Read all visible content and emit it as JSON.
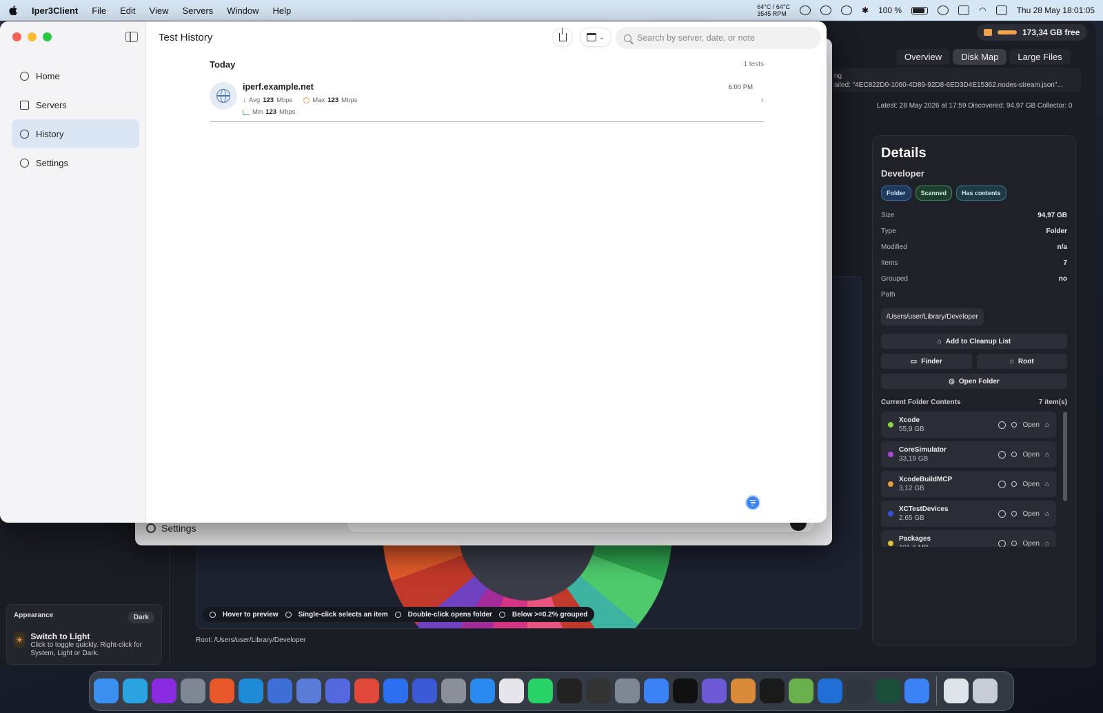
{
  "menubar": {
    "app_name": "Iper3Client",
    "menus": [
      "File",
      "Edit",
      "View",
      "Servers",
      "Window",
      "Help"
    ],
    "temp_line1": "64°C / 64°C",
    "temp_line2": "3545 RPM",
    "battery": "100 %",
    "datetime": "Thu 28 May  18:01:05"
  },
  "background_app": {
    "free_space": "173,34 GB free",
    "tabs": [
      "Overview",
      "Disk Map",
      "Large Files"
    ],
    "active_tab": "Disk Map",
    "log_line1": "ng",
    "log_line2": "ailed: \"4EC822D0-1060-4D89-92D8-6ED3D4E15362.nodes-stream.json\"...",
    "status": "Latest: 28 May 2026 at 17:59   Discovered: 94,97 GB   Collector: 0",
    "details": {
      "title": "Details",
      "name": "Developer",
      "tags": [
        "Folder",
        "Scanned",
        "Has contents"
      ],
      "fields": [
        {
          "k": "Size",
          "v": "94,97 GB"
        },
        {
          "k": "Type",
          "v": "Folder"
        },
        {
          "k": "Modified",
          "v": "n/a"
        },
        {
          "k": "Items",
          "v": "7"
        },
        {
          "k": "Grouped",
          "v": "no"
        },
        {
          "k": "Path",
          "v": ""
        }
      ],
      "path": "/Users/user/Library/Developer",
      "add_cleanup": "Add to Cleanup List",
      "finder": "Finder",
      "root": "Root",
      "open_folder": "Open Folder",
      "contents_label": "Current Folder Contents",
      "contents_count": "7 item(s)",
      "items": [
        {
          "name": "Xcode",
          "size": "55,9 GB",
          "color": "#8bd14a"
        },
        {
          "name": "CoreSimulator",
          "size": "33,19 GB",
          "color": "#a64ad1"
        },
        {
          "name": "XcodeBuildMCP",
          "size": "3,12 GB",
          "color": "#e0a23a"
        },
        {
          "name": "XCTestDevices",
          "size": "2,65 GB",
          "color": "#3a4fd1"
        },
        {
          "name": "Packages",
          "size": "101,6 MB",
          "color": "#e0c23a"
        }
      ],
      "open_label": "Open"
    },
    "hints": [
      "Hover to preview",
      "Single-click selects an item",
      "Double-click opens folder",
      "Below >=0.2% grouped"
    ],
    "root_label": "Root: /Users/user/Library/Developer",
    "appearance": {
      "label": "Appearance",
      "mode": "Dark",
      "title": "Switch to Light",
      "subtitle": "Click to toggle quickly. Right-click for System, Light or Dark."
    }
  },
  "middle_window": {
    "settings_label": "Settings"
  },
  "main_window": {
    "title": "Test History",
    "search_placeholder": "Search by server, date, or note",
    "nav": [
      {
        "label": "Home",
        "icon": "gauge-icon"
      },
      {
        "label": "Servers",
        "icon": "server-icon"
      },
      {
        "label": "History",
        "icon": "clock-icon"
      },
      {
        "label": "Settings",
        "icon": "gear-icon"
      }
    ],
    "active_nav": "History",
    "section": {
      "day": "Today",
      "count": "1 tests"
    },
    "entry": {
      "server": "iperf.example.net",
      "time": "6:00 PM",
      "avg_label": "Avg",
      "avg_value": "123",
      "max_label": "Max",
      "max_value": "123",
      "min_label": "Min",
      "min_value": "123",
      "unit": "Mbps"
    }
  },
  "dock": {
    "apps": [
      {
        "name": "finder",
        "color": "#3b8ff0"
      },
      {
        "name": "telegram",
        "color": "#2aa3e0"
      },
      {
        "name": "phpstorm",
        "color": "#8a2be2"
      },
      {
        "name": "unknown",
        "color": "#7f8694"
      },
      {
        "name": "firefox",
        "color": "#e8582a"
      },
      {
        "name": "webstorm",
        "color": "#1f8ad6"
      },
      {
        "name": "editor",
        "color": "#3d6fd6"
      },
      {
        "name": "instruments",
        "color": "#5a7bd6"
      },
      {
        "name": "proxyman",
        "color": "#5468e0"
      },
      {
        "name": "chrome",
        "color": "#e0493a"
      },
      {
        "name": "terminal-app",
        "color": "#2b6ff0"
      },
      {
        "name": "copilot",
        "color": "#3a5ad6"
      },
      {
        "name": "system-settings",
        "color": "#8a8f99"
      },
      {
        "name": "app-store",
        "color": "#2b8af0"
      },
      {
        "name": "launchpad",
        "color": "#e6e6ea"
      },
      {
        "name": "whatsapp",
        "color": "#25d366"
      },
      {
        "name": "chatgpt",
        "color": "#222222"
      },
      {
        "name": "sequel",
        "color": "#333333"
      },
      {
        "name": "help",
        "color": "#7f8694"
      },
      {
        "name": "gemini",
        "color": "#3b82f6"
      },
      {
        "name": "perplexity",
        "color": "#111111"
      },
      {
        "name": "linear",
        "color": "#6e59d6"
      },
      {
        "name": "retriever",
        "color": "#d98b3a"
      },
      {
        "name": "terminal",
        "color": "#1a1a1a"
      },
      {
        "name": "script-editor",
        "color": "#6ab04c"
      },
      {
        "name": "xcode",
        "color": "#1f6fd6"
      },
      {
        "name": "activity-monitor",
        "color": "#2f3640"
      },
      {
        "name": "radar",
        "color": "#1a4d3a"
      },
      {
        "name": "stats",
        "color": "#3b82f6"
      },
      {
        "name": "documents",
        "color": "#dfe3ea"
      },
      {
        "name": "trash",
        "color": "#c8ccd4"
      }
    ]
  }
}
